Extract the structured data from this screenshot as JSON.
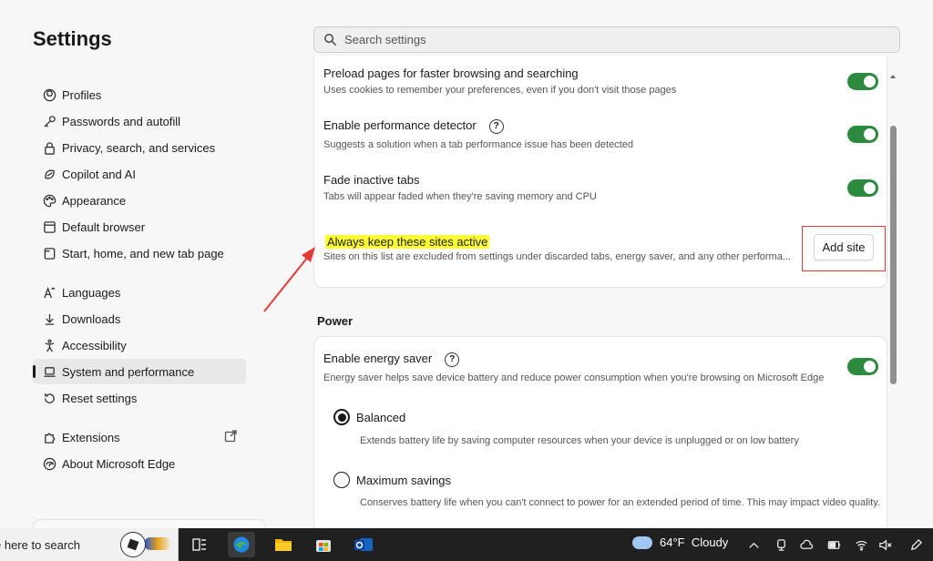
{
  "sidebar": {
    "title": "Settings",
    "items": [
      {
        "label": "Profiles",
        "icon": "profile-icon"
      },
      {
        "label": "Passwords and autofill",
        "icon": "key-icon"
      },
      {
        "label": "Privacy, search, and services",
        "icon": "lock-icon"
      },
      {
        "label": "Copilot and AI",
        "icon": "copilot-icon"
      },
      {
        "label": "Appearance",
        "icon": "palette-icon"
      },
      {
        "label": "Default browser",
        "icon": "browser-icon"
      },
      {
        "label": "Start, home, and new tab page",
        "icon": "home-icon"
      },
      {
        "label": "Languages",
        "icon": "languages-icon"
      },
      {
        "label": "Downloads",
        "icon": "download-icon"
      },
      {
        "label": "Accessibility",
        "icon": "accessibility-icon"
      },
      {
        "label": "System and performance",
        "icon": "laptop-icon",
        "active": true
      },
      {
        "label": "Reset settings",
        "icon": "reset-icon"
      },
      {
        "label": "Extensions",
        "icon": "puzzle-icon"
      },
      {
        "label": "About Microsoft Edge",
        "icon": "edge-icon"
      }
    ]
  },
  "search": {
    "placeholder": "Search settings"
  },
  "performance": {
    "preload": {
      "title": "Preload pages for faster browsing and searching",
      "desc": "Uses cookies to remember your preferences, even if you don't visit those pages",
      "enabled": true
    },
    "detector": {
      "title": "Enable performance detector",
      "help": "?",
      "desc": "Suggests a solution when a tab performance issue has been detected",
      "enabled": true
    },
    "fade": {
      "title": "Fade inactive tabs",
      "desc": "Tabs will appear faded when they're saving memory and CPU",
      "enabled": true
    },
    "keep_active": {
      "title": "Always keep these sites active",
      "desc": "Sites on this list are excluded from settings under discarded tabs, energy saver, and any other performa...",
      "button": "Add site"
    }
  },
  "power": {
    "heading": "Power",
    "energy_saver": {
      "title": "Enable energy saver",
      "help": "?",
      "desc": "Energy saver helps save device battery and reduce power consumption when you're browsing on Microsoft Edge",
      "enabled": true
    },
    "options": [
      {
        "title": "Balanced",
        "desc": "Extends battery life by saving computer resources when your device is unplugged or on low battery",
        "selected": true
      },
      {
        "title": "Maximum savings",
        "desc": "Conserves battery life when you can't connect to power for an extended period of time. This may impact video quality.",
        "selected": false
      }
    ]
  },
  "taskbar": {
    "search_text": "e here to search",
    "weather": {
      "temp": "64°F",
      "condition": "Cloudy"
    }
  },
  "colors": {
    "accent_green": "#2b8a3e",
    "highlight": "#ffff33",
    "callout_red": "#e53935"
  }
}
